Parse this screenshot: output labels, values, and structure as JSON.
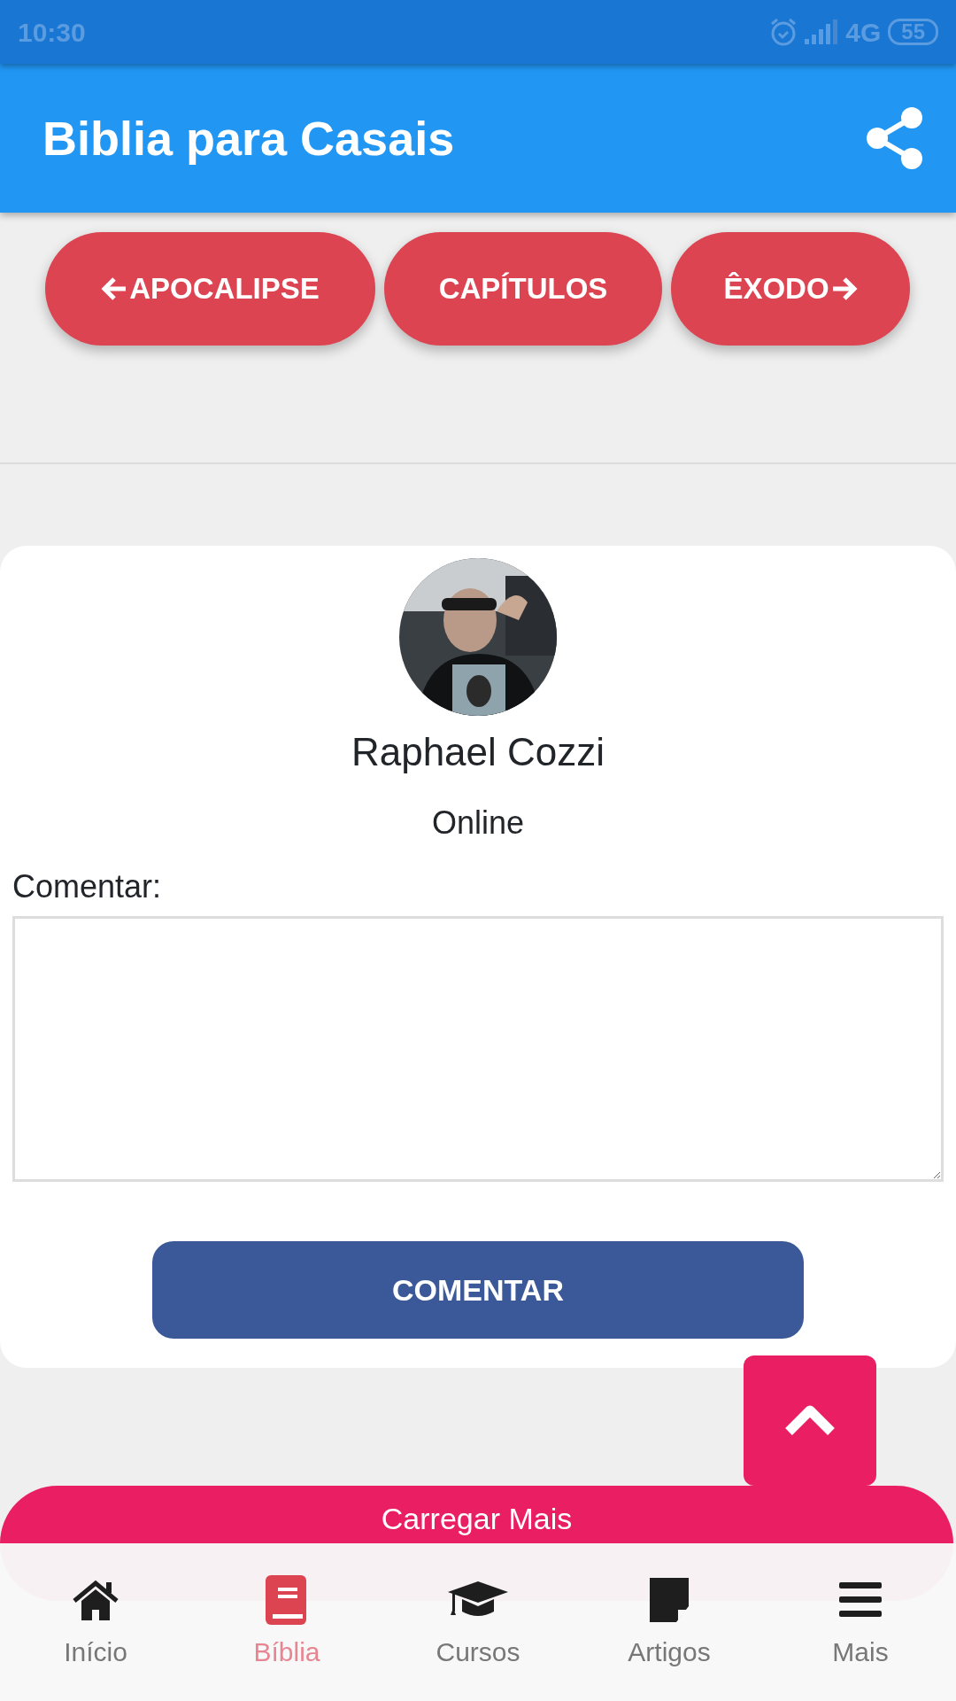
{
  "status_bar": {
    "time": "10:30",
    "network": "4G",
    "battery": "55"
  },
  "app_bar": {
    "title": "Biblia para Casais"
  },
  "chapter_nav": [
    {
      "label": "APOCALIPSE",
      "kind": "prev"
    },
    {
      "label": "CAPÍTULOS",
      "kind": "list"
    },
    {
      "label": "ÊXODO",
      "kind": "next"
    }
  ],
  "profile": {
    "name": "Raphael Cozzi",
    "status": "Online"
  },
  "comment_form": {
    "label": "Comentar:",
    "submit": "COMENTAR"
  },
  "load_more": "Carregar Mais",
  "bottom_nav": [
    {
      "label": "Início",
      "selected": false
    },
    {
      "label": "Bíblia",
      "selected": true
    },
    {
      "label": "Cursos",
      "selected": false
    },
    {
      "label": "Artigos",
      "selected": false
    },
    {
      "label": "Mais",
      "selected": false
    }
  ]
}
